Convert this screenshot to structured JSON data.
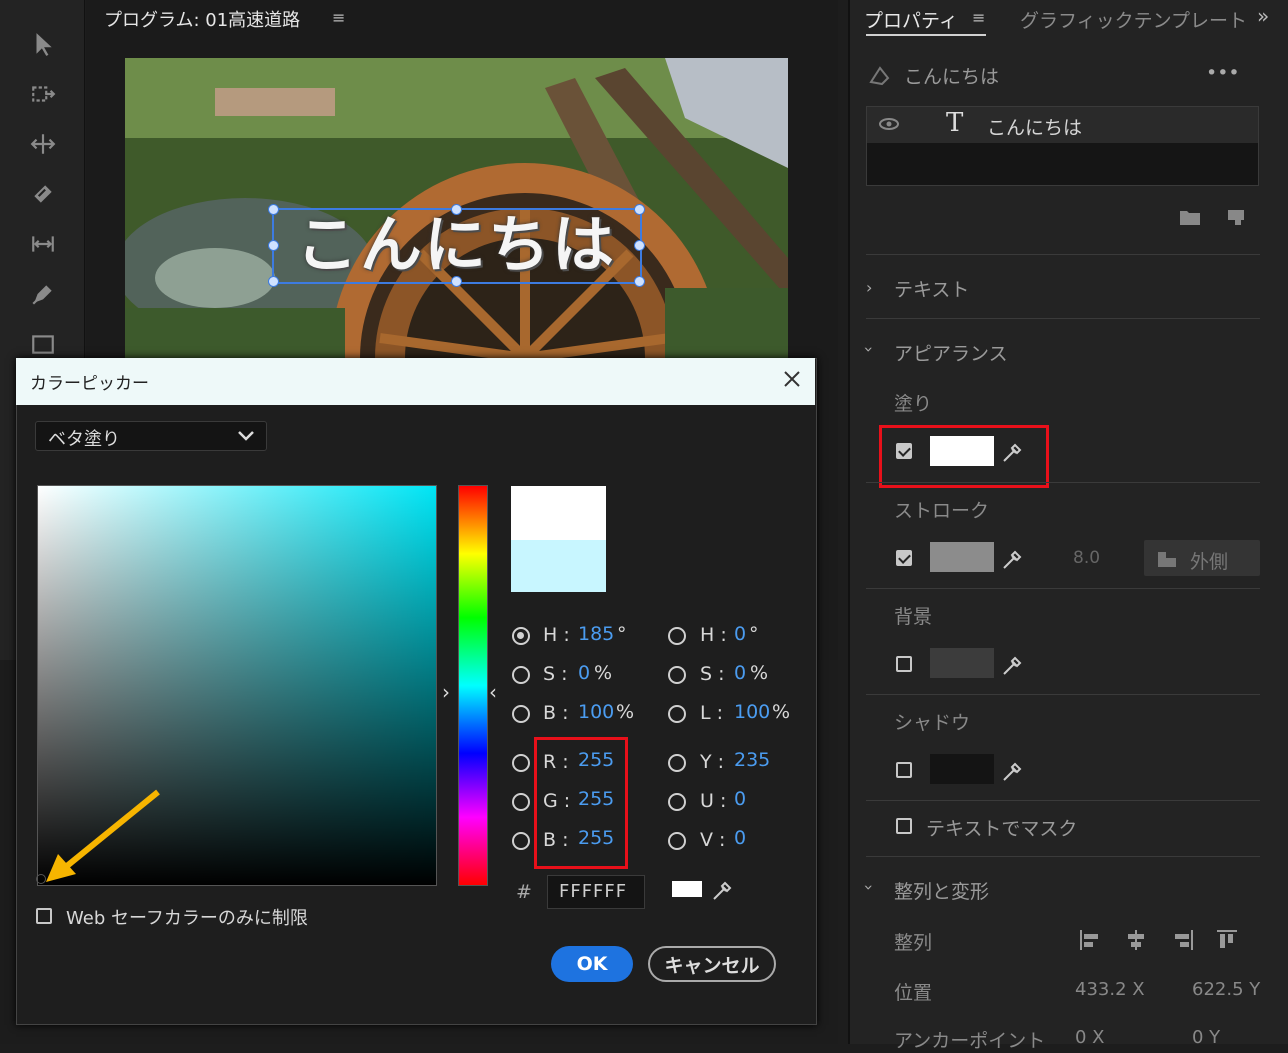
{
  "colors": {
    "accent": "#1e73e0",
    "highlight": "#e8101a",
    "arrow": "#f7b500",
    "value_blue": "#4b9cf0"
  },
  "monitor": {
    "title": "プログラム: 01高速道路",
    "menu_icon": "hamburger-icon",
    "caption_text": "こんにちは"
  },
  "toolbar": {
    "tools": [
      "selection-tool-icon",
      "track-select-icon",
      "ripple-edit-icon",
      "razor-icon",
      "slip-icon",
      "pen-icon",
      "rectangle-icon"
    ]
  },
  "properties": {
    "tab_active": "プロパティ",
    "tab_inactive": "グラフィックテンプレート",
    "layer_header": "こんにちは",
    "layer_name": "こんにちは",
    "section_text": "テキスト",
    "section_appearance": "アピアランス",
    "fill_label": "塗り",
    "stroke_label": "ストローク",
    "stroke_width": "8.0",
    "stroke_position": "外側",
    "background_label": "背景",
    "shadow_label": "シャドウ",
    "mask_label": "テキストでマスク",
    "section_align": "整列と変形",
    "align_label": "整列",
    "position_label": "位置",
    "position_x": "433.2 X",
    "position_y": "622.5 Y",
    "anchor_label": "アンカーポイント",
    "anchor_x": "0 X",
    "anchor_y": "0 Y",
    "fill_checked": true,
    "stroke_checked": true,
    "background_checked": false,
    "shadow_checked": false,
    "mask_checked": false
  },
  "picker": {
    "title": "カラーピッカー",
    "fill_type": "ベタ塗り",
    "hsb": {
      "h_label": "H :",
      "h": "185",
      "h_unit": "°",
      "s_label": "S :",
      "s": "0",
      "s_unit": "%",
      "b_label": "B :",
      "b": "100",
      "b_unit": "%"
    },
    "hsl": {
      "h_label": "H :",
      "h": "0",
      "h_unit": "°",
      "s_label": "S :",
      "s": "0",
      "s_unit": "%",
      "l_label": "L :",
      "l": "100",
      "l_unit": "%"
    },
    "rgb": {
      "r_label": "R :",
      "r": "255",
      "g_label": "G :",
      "g": "255",
      "b_label": "B :",
      "b": "255"
    },
    "yuv": {
      "y_label": "Y :",
      "y": "235",
      "u_label": "U :",
      "u": "0",
      "v_label": "V :",
      "v": "0"
    },
    "hex_symbol": "#",
    "hex": "FFFFFF",
    "web_safe_label": "Web セーフカラーのみに制限",
    "ok": "OK",
    "cancel": "キャンセル"
  }
}
